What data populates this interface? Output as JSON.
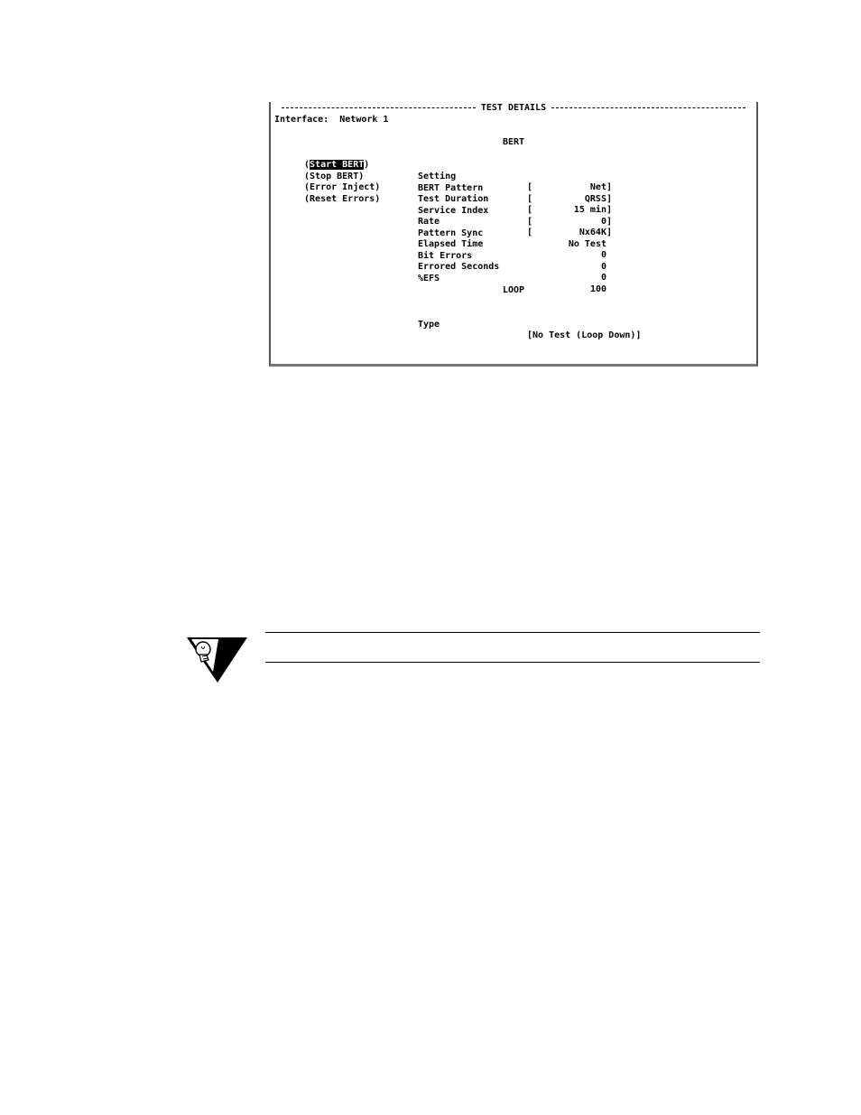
{
  "terminal": {
    "title": "TEST DETAILS",
    "interface_label": "Interface:",
    "interface_value": "Network 1",
    "bert_heading": "BERT",
    "actions": [
      {
        "open": "(",
        "label": "Start BERT",
        "close": ")",
        "selected": true
      },
      {
        "open": "(",
        "label": "Stop BERT",
        "close": ")",
        "selected": false
      },
      {
        "open": "(",
        "label": "Error Inject",
        "close": ")",
        "selected": false
      },
      {
        "open": "(",
        "label": "Reset Errors",
        "close": ")",
        "selected": false
      }
    ],
    "fields": [
      {
        "label": "Setting",
        "value": "Net]"
      },
      {
        "label": "BERT Pattern",
        "value": "QRSS]"
      },
      {
        "label": "Test Duration",
        "value": "15 min]"
      },
      {
        "label": "Service Index",
        "value": "0]"
      },
      {
        "label": "Rate",
        "value": "Nx64K]"
      }
    ],
    "bracket_open": "[",
    "status": [
      {
        "label": "Pattern Sync",
        "value": "No Test"
      },
      {
        "label": "Elapsed Time",
        "value": "0"
      },
      {
        "label": "Bit Errors",
        "value": "0"
      },
      {
        "label": "Errored Seconds",
        "value": "0"
      },
      {
        "label": "%EFS",
        "value": "100"
      }
    ],
    "loop_heading": "LOOP",
    "loop_type_label": "Type",
    "loop_type_value": "[No Test (Loop Down)]"
  },
  "note_icon": "lightbulb-tip-icon"
}
